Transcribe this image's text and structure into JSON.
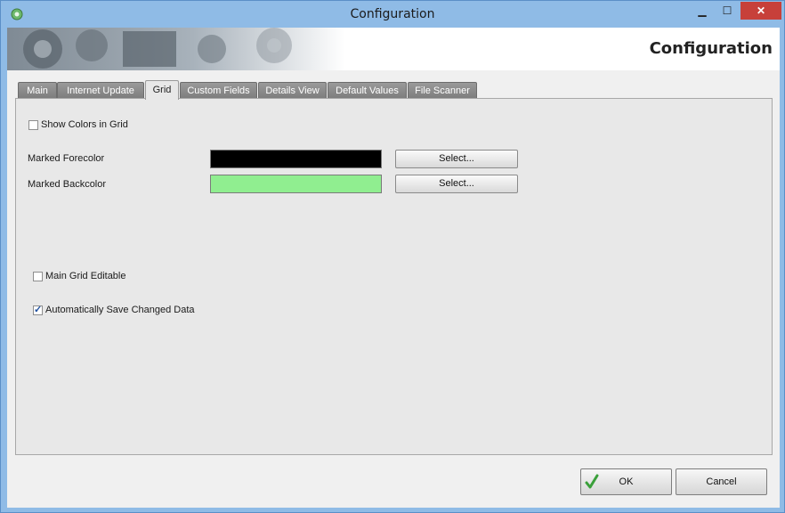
{
  "window": {
    "title": "Configuration",
    "controls": {
      "minimize": "▁",
      "maximize": "☐",
      "close": "✕"
    }
  },
  "banner": {
    "title": "Configuration"
  },
  "tabs": [
    {
      "label": "Main"
    },
    {
      "label": "Internet Update"
    },
    {
      "label": "Grid",
      "active": true
    },
    {
      "label": "Custom Fields"
    },
    {
      "label": "Details View"
    },
    {
      "label": "Default Values"
    },
    {
      "label": "File Scanner"
    }
  ],
  "grid": {
    "show_colors_label": "Show Colors in Grid",
    "show_colors_checked": false,
    "marked_forecolor_label": "Marked Forecolor",
    "marked_forecolor_value": "#000000",
    "marked_backcolor_label": "Marked Backcolor",
    "marked_backcolor_value": "#90ee90",
    "select_label": "Select...",
    "main_grid_editable_label": "Main Grid Editable",
    "main_grid_editable_checked": false,
    "auto_save_label": "Automatically Save Changed Data",
    "auto_save_checked": true
  },
  "footer": {
    "ok_label": "OK",
    "cancel_label": "Cancel"
  },
  "colors": {
    "accent": "#c7403a",
    "window_frame": "#8fbbe6"
  }
}
